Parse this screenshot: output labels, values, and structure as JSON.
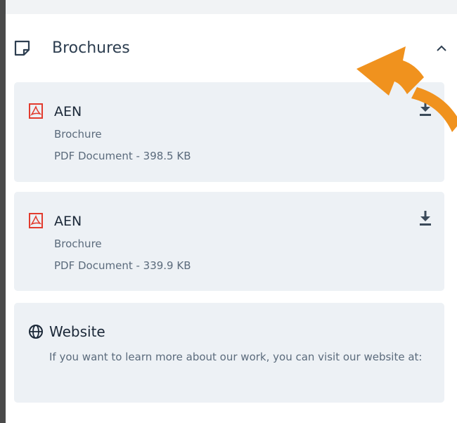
{
  "section": {
    "title": "Brochures",
    "header_icon": "note-icon",
    "toggle_icon": "chevron-up-icon"
  },
  "files": [
    {
      "title": "AEN",
      "type": "Brochure",
      "details": "PDF Document - 398.5 KB",
      "icon": "pdf-file-icon",
      "action_icon": "download-icon"
    },
    {
      "title": "AEN",
      "type": "Brochure",
      "details": "PDF Document - 339.9 KB",
      "icon": "pdf-file-icon",
      "action_icon": "download-icon"
    }
  ],
  "website": {
    "title": "Website",
    "description": "If you want to learn more about our work, you can visit our website at:",
    "icon": "globe-icon"
  },
  "colors": {
    "accent_arrow": "#f0921e",
    "pdf_red": "#e23b2e",
    "card_bg": "#edf1f5",
    "frame_bg": "#4a4a4a"
  }
}
